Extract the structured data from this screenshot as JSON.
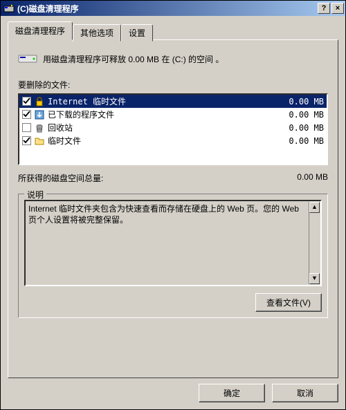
{
  "titlebar": {
    "title": "(C)磁盘清理程序",
    "help": "?",
    "close": "×"
  },
  "tabs": {
    "t0": "磁盘清理程序",
    "t1": "其他选项",
    "t2": "设置"
  },
  "summary": "用磁盘清理程序可释放 0.00 MB 在 (C:) 的空间 。",
  "files_label": "要删除的文件:",
  "files": [
    {
      "checked": true,
      "icon": "lock-icon",
      "name": "Internet 临时文件",
      "size": "0.00 MB",
      "selected": true
    },
    {
      "checked": true,
      "icon": "download-icon",
      "name": "已下载的程序文件",
      "size": "0.00 MB",
      "selected": false
    },
    {
      "checked": false,
      "icon": "recycle-icon",
      "name": "回收站",
      "size": "0.00 MB",
      "selected": false
    },
    {
      "checked": true,
      "icon": "folder-icon",
      "name": "临时文件",
      "size": "0.00 MB",
      "selected": false
    }
  ],
  "total": {
    "label": "所获得的磁盘空间总量:",
    "value": "0.00 MB"
  },
  "description": {
    "legend": "说明",
    "text": "Internet 临时文件夹包含为快速查看而存储在硬盘上的 Web 页。您的 Web 页个人设置将被完整保留。"
  },
  "buttons": {
    "view_files": "查看文件(V)",
    "ok": "确定",
    "cancel": "取消"
  }
}
